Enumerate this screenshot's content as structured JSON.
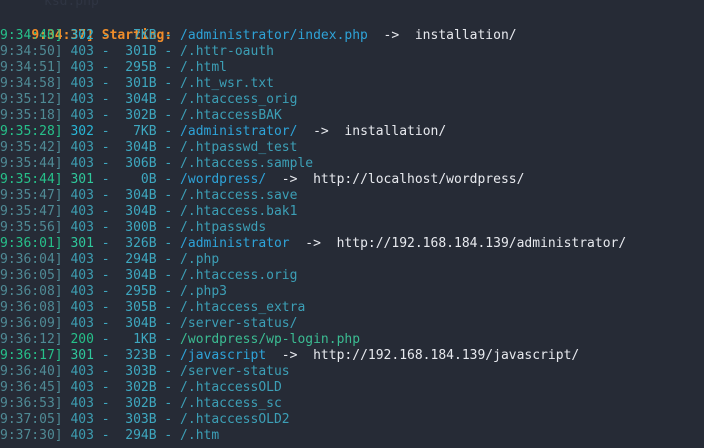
{
  "terminal": {
    "start": {
      "time": "9:34:37]",
      "label": "Starting:"
    },
    "background_text": "ksd.php",
    "entries": [
      {
        "time": "9:34:40]",
        "code": "302",
        "size": "7KB",
        "path": "/administrator/index.php",
        "arrow": "->",
        "target": "installation/"
      },
      {
        "time": "9:34:50]",
        "code": "403",
        "size": "301B",
        "path": "/.httr-oauth"
      },
      {
        "time": "9:34:51]",
        "code": "403",
        "size": "295B",
        "path": "/.html"
      },
      {
        "time": "9:34:58]",
        "code": "403",
        "size": "301B",
        "path": "/.ht_wsr.txt"
      },
      {
        "time": "9:35:12]",
        "code": "403",
        "size": "304B",
        "path": "/.htaccess_orig"
      },
      {
        "time": "9:35:18]",
        "code": "403",
        "size": "302B",
        "path": "/.htaccessBAK"
      },
      {
        "time": "9:35:28]",
        "code": "302",
        "size": "7KB",
        "path": "/administrator/",
        "arrow": "->",
        "target": "installation/"
      },
      {
        "time": "9:35:42]",
        "code": "403",
        "size": "304B",
        "path": "/.htpasswd_test"
      },
      {
        "time": "9:35:44]",
        "code": "403",
        "size": "306B",
        "path": "/.htaccess.sample"
      },
      {
        "time": "9:35:44]",
        "code": "301",
        "size": "0B",
        "path": "/wordpress/",
        "arrow": "->",
        "target": "http://localhost/wordpress/"
      },
      {
        "time": "9:35:47]",
        "code": "403",
        "size": "304B",
        "path": "/.htaccess.save"
      },
      {
        "time": "9:35:47]",
        "code": "403",
        "size": "304B",
        "path": "/.htaccess.bak1"
      },
      {
        "time": "9:35:56]",
        "code": "403",
        "size": "300B",
        "path": "/.htpasswds"
      },
      {
        "time": "9:36:01]",
        "code": "301",
        "size": "326B",
        "path": "/administrator",
        "arrow": "->",
        "target": "http://192.168.184.139/administrator/"
      },
      {
        "time": "9:36:04]",
        "code": "403",
        "size": "294B",
        "path": "/.php"
      },
      {
        "time": "9:36:05]",
        "code": "403",
        "size": "304B",
        "path": "/.htaccess.orig"
      },
      {
        "time": "9:36:08]",
        "code": "403",
        "size": "295B",
        "path": "/.php3"
      },
      {
        "time": "9:36:08]",
        "code": "403",
        "size": "305B",
        "path": "/.htaccess_extra"
      },
      {
        "time": "9:36:09]",
        "code": "403",
        "size": "304B",
        "path": "/server-status/"
      },
      {
        "time": "9:36:12]",
        "code": "200",
        "size": "1KB",
        "path": "/wordpress/wp-login.php"
      },
      {
        "time": "9:36:17]",
        "code": "301",
        "size": "323B",
        "path": "/javascript",
        "arrow": "->",
        "target": "http://192.168.184.139/javascript/"
      },
      {
        "time": "9:36:40]",
        "code": "403",
        "size": "303B",
        "path": "/server-status"
      },
      {
        "time": "9:36:45]",
        "code": "403",
        "size": "302B",
        "path": "/.htaccessOLD"
      },
      {
        "time": "9:36:53]",
        "code": "403",
        "size": "302B",
        "path": "/.htaccess_sc"
      },
      {
        "time": "9:37:05]",
        "code": "403",
        "size": "303B",
        "path": "/.htaccessOLD2"
      },
      {
        "time": "9:37:30]",
        "code": "403",
        "size": "294B",
        "path": "/.htm"
      }
    ]
  }
}
